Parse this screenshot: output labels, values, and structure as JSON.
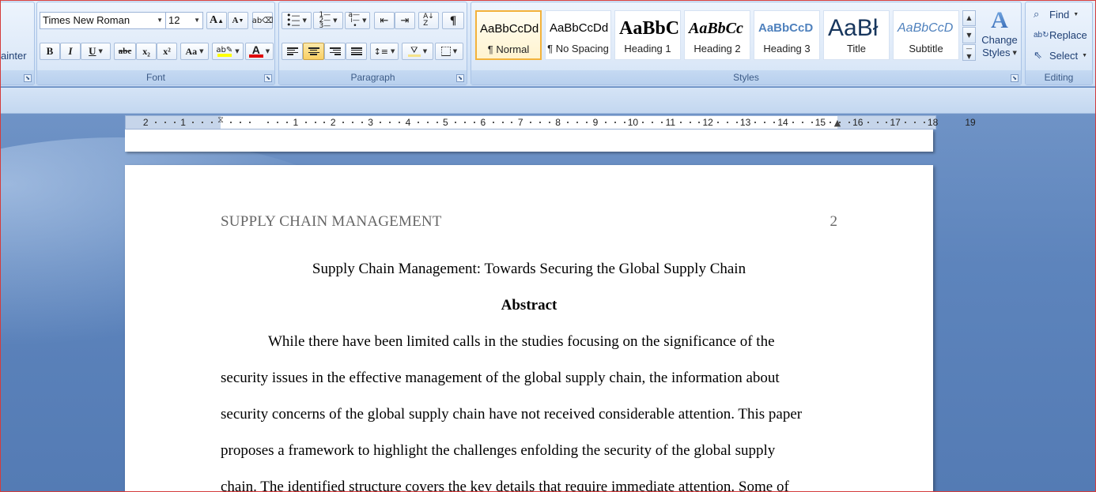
{
  "clipboard": {
    "format_painter_fragment": "ainter"
  },
  "font": {
    "group_label": "Font",
    "name": "Times New Roman",
    "size": "12",
    "grow": "A",
    "shrink": "A",
    "bold": "B",
    "italic": "I",
    "underline": "U",
    "strikethrough": "abc",
    "subscript": "x₂",
    "superscript": "x²",
    "change_case": "Aa",
    "highlight_color": "#ffff00",
    "font_color": "#e00000"
  },
  "paragraph": {
    "group_label": "Paragraph",
    "pilcrow": "¶"
  },
  "styles": {
    "group_label": "Styles",
    "tiles": [
      {
        "preview": "AaBbCcDd",
        "name": "¶ Normal"
      },
      {
        "preview": "AaBbCcDd",
        "name": "¶ No Spacing"
      },
      {
        "preview": "AaBbC",
        "name": "Heading 1"
      },
      {
        "preview": "AaBbCc",
        "name": "Heading 2"
      },
      {
        "preview": "AaBbCcD",
        "name": "Heading 3"
      },
      {
        "preview": "AaBł",
        "name": "Title"
      },
      {
        "preview": "AaBbCcD",
        "name": "Subtitle"
      }
    ],
    "change_styles_line1": "Change",
    "change_styles_line2": "Styles"
  },
  "editing": {
    "group_label": "Editing",
    "find": "Find",
    "replace": "Replace",
    "select": "Select"
  },
  "ruler": {
    "labels": [
      "2",
      "1",
      "1",
      "2",
      "3",
      "4",
      "5",
      "6",
      "7",
      "8",
      "9",
      "10",
      "11",
      "12",
      "13",
      "14",
      "15",
      "16",
      "17",
      "18",
      "19"
    ]
  },
  "document": {
    "running_head": "SUPPLY CHAIN MANAGEMENT",
    "page_number": "2",
    "title": "Supply Chain Management: Towards Securing the Global Supply Chain",
    "heading": "Abstract",
    "lines": [
      "While there have been limited calls in the studies focusing on the significance of the",
      "security issues in the effective management of the global supply chain, the information about",
      "security concerns of the global supply chain have not received considerable attention. This paper",
      "proposes a framework to highlight the challenges enfolding the security of the global supply",
      "chain. The identified structure covers the key details that require immediate attention. Some of"
    ]
  }
}
